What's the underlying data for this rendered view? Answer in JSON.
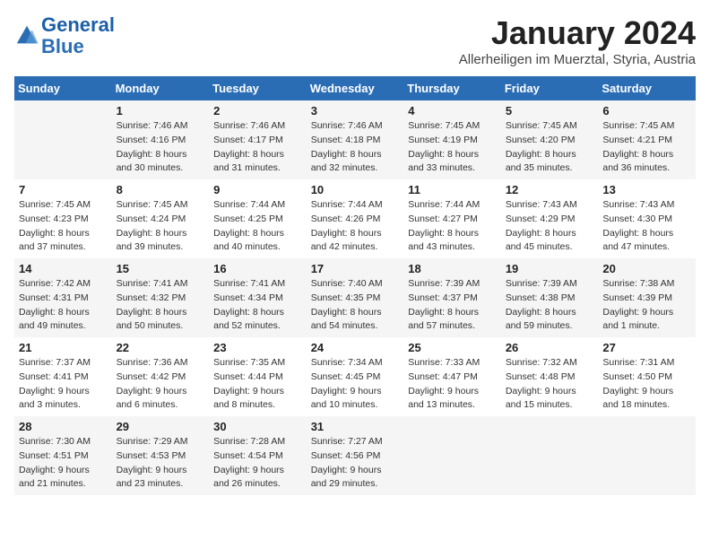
{
  "header": {
    "logo_line1": "General",
    "logo_line2": "Blue",
    "month": "January 2024",
    "location": "Allerheiligen im Muerztal, Styria, Austria"
  },
  "weekdays": [
    "Sunday",
    "Monday",
    "Tuesday",
    "Wednesday",
    "Thursday",
    "Friday",
    "Saturday"
  ],
  "weeks": [
    [
      {
        "day": "",
        "sunrise": "",
        "sunset": "",
        "daylight": ""
      },
      {
        "day": "1",
        "sunrise": "Sunrise: 7:46 AM",
        "sunset": "Sunset: 4:16 PM",
        "daylight": "Daylight: 8 hours and 30 minutes."
      },
      {
        "day": "2",
        "sunrise": "Sunrise: 7:46 AM",
        "sunset": "Sunset: 4:17 PM",
        "daylight": "Daylight: 8 hours and 31 minutes."
      },
      {
        "day": "3",
        "sunrise": "Sunrise: 7:46 AM",
        "sunset": "Sunset: 4:18 PM",
        "daylight": "Daylight: 8 hours and 32 minutes."
      },
      {
        "day": "4",
        "sunrise": "Sunrise: 7:45 AM",
        "sunset": "Sunset: 4:19 PM",
        "daylight": "Daylight: 8 hours and 33 minutes."
      },
      {
        "day": "5",
        "sunrise": "Sunrise: 7:45 AM",
        "sunset": "Sunset: 4:20 PM",
        "daylight": "Daylight: 8 hours and 35 minutes."
      },
      {
        "day": "6",
        "sunrise": "Sunrise: 7:45 AM",
        "sunset": "Sunset: 4:21 PM",
        "daylight": "Daylight: 8 hours and 36 minutes."
      }
    ],
    [
      {
        "day": "7",
        "sunrise": "Sunrise: 7:45 AM",
        "sunset": "Sunset: 4:23 PM",
        "daylight": "Daylight: 8 hours and 37 minutes."
      },
      {
        "day": "8",
        "sunrise": "Sunrise: 7:45 AM",
        "sunset": "Sunset: 4:24 PM",
        "daylight": "Daylight: 8 hours and 39 minutes."
      },
      {
        "day": "9",
        "sunrise": "Sunrise: 7:44 AM",
        "sunset": "Sunset: 4:25 PM",
        "daylight": "Daylight: 8 hours and 40 minutes."
      },
      {
        "day": "10",
        "sunrise": "Sunrise: 7:44 AM",
        "sunset": "Sunset: 4:26 PM",
        "daylight": "Daylight: 8 hours and 42 minutes."
      },
      {
        "day": "11",
        "sunrise": "Sunrise: 7:44 AM",
        "sunset": "Sunset: 4:27 PM",
        "daylight": "Daylight: 8 hours and 43 minutes."
      },
      {
        "day": "12",
        "sunrise": "Sunrise: 7:43 AM",
        "sunset": "Sunset: 4:29 PM",
        "daylight": "Daylight: 8 hours and 45 minutes."
      },
      {
        "day": "13",
        "sunrise": "Sunrise: 7:43 AM",
        "sunset": "Sunset: 4:30 PM",
        "daylight": "Daylight: 8 hours and 47 minutes."
      }
    ],
    [
      {
        "day": "14",
        "sunrise": "Sunrise: 7:42 AM",
        "sunset": "Sunset: 4:31 PM",
        "daylight": "Daylight: 8 hours and 49 minutes."
      },
      {
        "day": "15",
        "sunrise": "Sunrise: 7:41 AM",
        "sunset": "Sunset: 4:32 PM",
        "daylight": "Daylight: 8 hours and 50 minutes."
      },
      {
        "day": "16",
        "sunrise": "Sunrise: 7:41 AM",
        "sunset": "Sunset: 4:34 PM",
        "daylight": "Daylight: 8 hours and 52 minutes."
      },
      {
        "day": "17",
        "sunrise": "Sunrise: 7:40 AM",
        "sunset": "Sunset: 4:35 PM",
        "daylight": "Daylight: 8 hours and 54 minutes."
      },
      {
        "day": "18",
        "sunrise": "Sunrise: 7:39 AM",
        "sunset": "Sunset: 4:37 PM",
        "daylight": "Daylight: 8 hours and 57 minutes."
      },
      {
        "day": "19",
        "sunrise": "Sunrise: 7:39 AM",
        "sunset": "Sunset: 4:38 PM",
        "daylight": "Daylight: 8 hours and 59 minutes."
      },
      {
        "day": "20",
        "sunrise": "Sunrise: 7:38 AM",
        "sunset": "Sunset: 4:39 PM",
        "daylight": "Daylight: 9 hours and 1 minute."
      }
    ],
    [
      {
        "day": "21",
        "sunrise": "Sunrise: 7:37 AM",
        "sunset": "Sunset: 4:41 PM",
        "daylight": "Daylight: 9 hours and 3 minutes."
      },
      {
        "day": "22",
        "sunrise": "Sunrise: 7:36 AM",
        "sunset": "Sunset: 4:42 PM",
        "daylight": "Daylight: 9 hours and 6 minutes."
      },
      {
        "day": "23",
        "sunrise": "Sunrise: 7:35 AM",
        "sunset": "Sunset: 4:44 PM",
        "daylight": "Daylight: 9 hours and 8 minutes."
      },
      {
        "day": "24",
        "sunrise": "Sunrise: 7:34 AM",
        "sunset": "Sunset: 4:45 PM",
        "daylight": "Daylight: 9 hours and 10 minutes."
      },
      {
        "day": "25",
        "sunrise": "Sunrise: 7:33 AM",
        "sunset": "Sunset: 4:47 PM",
        "daylight": "Daylight: 9 hours and 13 minutes."
      },
      {
        "day": "26",
        "sunrise": "Sunrise: 7:32 AM",
        "sunset": "Sunset: 4:48 PM",
        "daylight": "Daylight: 9 hours and 15 minutes."
      },
      {
        "day": "27",
        "sunrise": "Sunrise: 7:31 AM",
        "sunset": "Sunset: 4:50 PM",
        "daylight": "Daylight: 9 hours and 18 minutes."
      }
    ],
    [
      {
        "day": "28",
        "sunrise": "Sunrise: 7:30 AM",
        "sunset": "Sunset: 4:51 PM",
        "daylight": "Daylight: 9 hours and 21 minutes."
      },
      {
        "day": "29",
        "sunrise": "Sunrise: 7:29 AM",
        "sunset": "Sunset: 4:53 PM",
        "daylight": "Daylight: 9 hours and 23 minutes."
      },
      {
        "day": "30",
        "sunrise": "Sunrise: 7:28 AM",
        "sunset": "Sunset: 4:54 PM",
        "daylight": "Daylight: 9 hours and 26 minutes."
      },
      {
        "day": "31",
        "sunrise": "Sunrise: 7:27 AM",
        "sunset": "Sunset: 4:56 PM",
        "daylight": "Daylight: 9 hours and 29 minutes."
      },
      {
        "day": "",
        "sunrise": "",
        "sunset": "",
        "daylight": ""
      },
      {
        "day": "",
        "sunrise": "",
        "sunset": "",
        "daylight": ""
      },
      {
        "day": "",
        "sunrise": "",
        "sunset": "",
        "daylight": ""
      }
    ]
  ]
}
